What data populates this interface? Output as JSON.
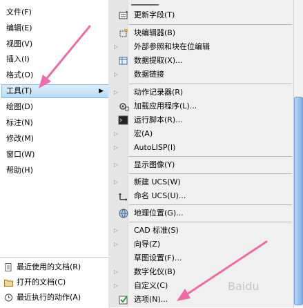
{
  "left_menu": {
    "items": [
      {
        "label": "文件(F)"
      },
      {
        "label": "编辑(E)"
      },
      {
        "label": "视图(V)"
      },
      {
        "label": "插入(I)"
      },
      {
        "label": "格式(O)"
      },
      {
        "label": "工具(T)"
      },
      {
        "label": "绘图(D)"
      },
      {
        "label": "标注(N)"
      },
      {
        "label": "修改(M)"
      },
      {
        "label": "窗口(W)"
      },
      {
        "label": "帮助(H)"
      }
    ],
    "highlighted": "工具(T)",
    "submenu_arrow": "▶"
  },
  "recent_panel": {
    "items": [
      {
        "label": "最近使用的文档(R)",
        "icon": "document-icon"
      },
      {
        "label": "打开的文档(C)",
        "icon": "folder-icon"
      },
      {
        "label": "最近执行的动作(A)",
        "icon": "history-icon"
      }
    ]
  },
  "tools_submenu": {
    "items": [
      {
        "label": "更新字段(T)",
        "icon": "update-field-icon",
        "has_submenu": false
      },
      {
        "label": "块编辑器(B)",
        "icon": "block-editor-icon",
        "has_submenu": false
      },
      {
        "label": "外部参照和块在位编辑",
        "icon": "",
        "has_submenu": true
      },
      {
        "label": "数据提取(X)...",
        "icon": "data-extract-icon",
        "has_submenu": false
      },
      {
        "label": "数据链接",
        "icon": "",
        "has_submenu": true
      },
      {
        "label": "动作记录器(R)",
        "icon": "",
        "has_submenu": true
      },
      {
        "label": "加载应用程序(L)...",
        "icon": "load-app-icon",
        "has_submenu": false
      },
      {
        "label": "运行脚本(R)...",
        "icon": "script-icon",
        "has_submenu": false
      },
      {
        "label": "宏(A)",
        "icon": "",
        "has_submenu": true
      },
      {
        "label": "AutoLISP(I)",
        "icon": "",
        "has_submenu": true
      },
      {
        "label": "显示图像(Y)",
        "icon": "",
        "has_submenu": true
      },
      {
        "label": "新建 UCS(W)",
        "icon": "",
        "has_submenu": true
      },
      {
        "label": "命名 UCS(U)...",
        "icon": "named-ucs-icon",
        "has_submenu": false
      },
      {
        "label": "地理位置(G)...",
        "icon": "globe-icon",
        "has_submenu": false
      },
      {
        "label": "CAD 标准(S)",
        "icon": "",
        "has_submenu": true
      },
      {
        "label": "向导(Z)",
        "icon": "",
        "has_submenu": true
      },
      {
        "label": "草图设置(F)...",
        "icon": "",
        "has_submenu": false
      },
      {
        "label": "数字化仪(B)",
        "icon": "",
        "has_submenu": true
      },
      {
        "label": "自定义(C)",
        "icon": "",
        "has_submenu": true
      },
      {
        "label": "选项(N)...",
        "icon": "options-check-icon",
        "has_submenu": false
      }
    ],
    "submenu_triangle": "▷"
  },
  "colors": {
    "highlight_bg": "#b9dbf7",
    "pointer_arrow": "#f06aa6",
    "menu_bg": "#f0f0f0",
    "scroll_thumb": "#7fb0e6"
  },
  "watermark": "Baidu"
}
